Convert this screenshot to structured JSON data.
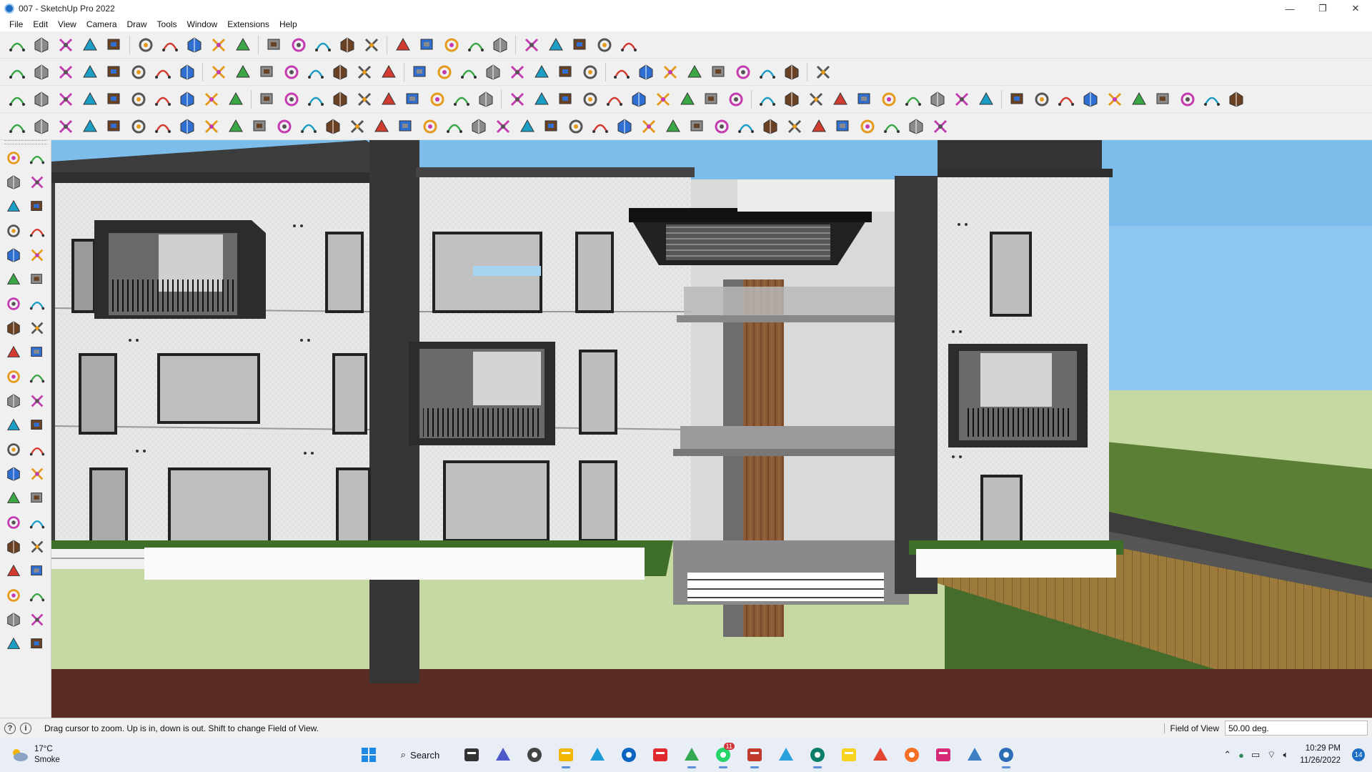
{
  "window": {
    "title": "007 - SketchUp Pro 2022",
    "controls": {
      "minimize": "—",
      "maximize": "❐",
      "close": "✕"
    }
  },
  "menu": [
    "File",
    "Edit",
    "View",
    "Camera",
    "Draw",
    "Tools",
    "Window",
    "Extensions",
    "Help"
  ],
  "toolbars": {
    "row1_icons": [
      "zoom-icon",
      "select-icon",
      "eraser-icon",
      "pencil-icon",
      "lasso-icon",
      "paint-bucket-icon",
      "push-pull-icon",
      "follow-me-icon",
      "move-icon",
      "rotate-icon",
      "scale-icon",
      "tape-measure-icon",
      "text-icon",
      "paint-icon",
      "section-plane-icon",
      "orbit-icon",
      "zoom-active-icon",
      "zoom-extents-icon",
      "component-icon",
      "layers-icon",
      "styles-icon",
      "scenes-icon",
      "profile-icon",
      "curve-icon",
      "walk-icon"
    ],
    "row2_icons": [
      "warehouse-icon",
      "box-icon",
      "house-icon",
      "texture-icon",
      "iso-icon",
      "edit-icon",
      "grid-icon",
      "copy-icon",
      "sandbox-icon",
      "blue-face-icon",
      "section-icon",
      "tag-icon",
      "wand-icon",
      "curve-a-icon",
      "curve-b-icon",
      "curve-c-icon",
      "curve-d-icon",
      "curve-e-icon",
      "curve-f-icon",
      "curve-g-icon",
      "curve-h-icon",
      "arrow-icon",
      "eraser-red-icon",
      "push-red-icon",
      "push-blue-icon",
      "push-orange-icon",
      "push-green-icon",
      "push-yellow-icon",
      "push-pink-icon",
      "push-gold-icon",
      "push-magenta-icon",
      "solid-icon",
      "render-icon"
    ],
    "row3_icons": [
      "component-a-icon",
      "funnel-icon",
      "circle-target-icon",
      "triangle-ruler-icon",
      "umbrella-icon",
      "burst-icon",
      "shell-icon",
      "sphere-icon",
      "layers-a-icon",
      "layers-b-icon",
      "mesh-a-icon",
      "mesh-b-icon",
      "mesh-c-icon",
      "mesh-d-icon",
      "mesh-e-icon",
      "lock-icon",
      "text-a-icon",
      "text-b-icon",
      "bowl-a-icon",
      "bowl-b-icon",
      "bowl-c-icon",
      "refresh-icon",
      "stairs-a-icon",
      "stairs-b-icon",
      "window-a-icon",
      "window-b-icon",
      "window-c-icon",
      "window-d-icon",
      "node-a-icon",
      "node-b-icon",
      "node-c-icon",
      "node-d-icon",
      "node-e-icon",
      "node-f-icon",
      "node-g-icon",
      "node-h-icon",
      "line-a-icon",
      "line-b-icon",
      "line-c-icon",
      "line-d-icon",
      "line-e-icon",
      "line-f-icon",
      "line-g-icon",
      "line-h-icon",
      "line-i-icon",
      "line-j-icon",
      "line-k-icon",
      "line-l-icon",
      "line-m-icon",
      "line-n-icon"
    ],
    "row4_icons": [
      "blue-plane-icon",
      "blue-plane-b-icon",
      "yellow-plane-icon",
      "green-plane-icon",
      "red-plane-icon",
      "white-plane-icon",
      "orange-ring-icon",
      "red-square-icon",
      "red-frame-icon",
      "flag-icon",
      "box-brown-icon",
      "chain-icon",
      "hook-icon",
      "spline-icon",
      "red-cross-icon",
      "green-cross-icon",
      "blue-x-icon",
      "cone-icon",
      "cone-b-icon",
      "warning-icon",
      "ring-a-icon",
      "ring-b-icon",
      "ring-c-icon",
      "move-blue-icon",
      "cup-icon",
      "magnet-icon",
      "tree-icon",
      "truck-icon",
      "gear-red-icon",
      "gear-red-b-icon",
      "red-gem-icon",
      "pattern-icon",
      "photo-icon",
      "grid-orange-icon",
      "grid-orange-b-icon",
      "grid-orange-c-icon",
      "scatter-icon",
      "arc-icon",
      "qr-icon"
    ]
  },
  "status": {
    "message": "Drag cursor to zoom.  Up is in, down is out. Shift to change Field of View.",
    "measure_label": "Field of View",
    "measure_value": "50.00 deg."
  },
  "taskbar": {
    "weather_temp": "17°C",
    "weather_desc": "Smoke",
    "search_label": "Search",
    "whatsapp_badge": "11",
    "time": "10:29 PM",
    "date": "11/26/2022",
    "notifications": "14",
    "apps": [
      "windows-icon",
      "task-view-icon",
      "teams-icon",
      "calculator-icon",
      "file-explorer-icon",
      "edge-icon",
      "store-icon",
      "opera-icon",
      "chrome-icon",
      "whatsapp-icon",
      "sketchup-icon",
      "telegram-icon",
      "sketchup-viewer-icon",
      "sticky-notes-icon",
      "grammarly-icon",
      "soundcloud-icon",
      "instagram-icon",
      "photos-icon",
      "snipping-icon"
    ]
  }
}
